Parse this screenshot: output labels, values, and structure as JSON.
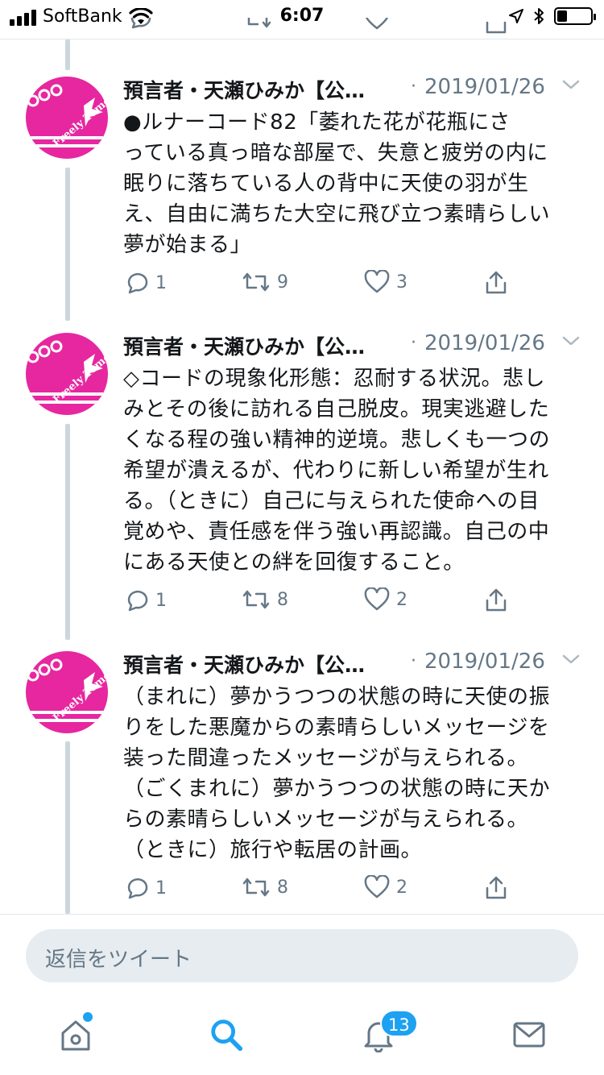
{
  "status_bar": {
    "carrier": "SoftBank",
    "time": "6:07"
  },
  "tweets": [
    {
      "author": "預言者・天瀬ひみか【公…",
      "separator": "·",
      "date": "2019/01/26",
      "text": "●ルナーコード82「萎れた花が花瓶にさ\nっている真っ暗な部屋で、失意と疲労の内に\n眠りに落ちている人の背中に天使の羽が生\nえ、自由に満ちた大空に飛び立つ素晴らしい\n夢が始まる」",
      "replies": "1",
      "retweets": "9",
      "likes": "3",
      "avatar_text": "Freely Tomorrow"
    },
    {
      "author": "預言者・天瀬ひみか【公…",
      "separator": "·",
      "date": "2019/01/26",
      "text": "◇コードの現象化形態：忍耐する状況。悲し\nみとその後に訪れる自己脱皮。現実逃避した\nくなる程の強い精神的逆境。悲しくも一つの\n希望が潰えるが、代わりに新しい希望が生れ\nる。（ときに）自己に与えられた使命への目\n覚めや、責任感を伴う強い再認識。自己の中\nにある天使との絆を回復すること。",
      "replies": "1",
      "retweets": "8",
      "likes": "2",
      "avatar_text": "Freely Tomorrow"
    },
    {
      "author": "預言者・天瀬ひみか【公…",
      "separator": "·",
      "date": "2019/01/26",
      "text": "（まれに）夢かうつつの状態の時に天使の振\nりをした悪魔からの素晴らしいメッセージを\n装った間違ったメッセージが与えられる。\n（ごくまれに）夢かうつつの状態の時に天か\nらの素晴らしいメッセージが与えられる。\n（ときに）旅行や転居の計画。",
      "replies": "1",
      "retweets": "8",
      "likes": "2",
      "avatar_text": "Freely Tomorrow"
    }
  ],
  "reply_bar": {
    "placeholder": "返信をツイート"
  },
  "tab_bar": {
    "notifications_badge": "13"
  },
  "colors": {
    "accent": "#1da1f2",
    "avatar_pink": "#e6279f",
    "muted": "#657786"
  }
}
